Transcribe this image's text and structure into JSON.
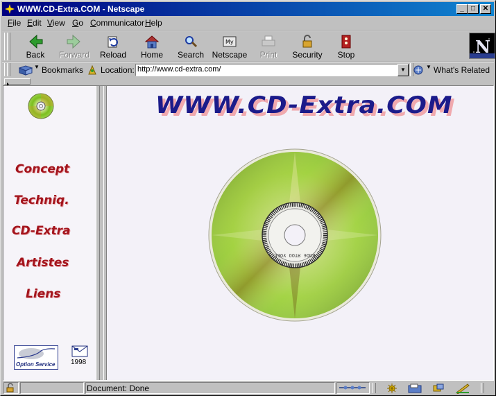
{
  "window": {
    "title": "WWW.CD-Extra.COM - Netscape"
  },
  "menu": [
    {
      "label": "File",
      "accel": "F"
    },
    {
      "label": "Edit",
      "accel": "E"
    },
    {
      "label": "View",
      "accel": "V"
    },
    {
      "label": "Go",
      "accel": "G"
    },
    {
      "label": "Communicator",
      "accel": "C"
    },
    {
      "label": "Help",
      "accel": "H"
    }
  ],
  "toolbar": {
    "back": "Back",
    "forward": "Forward",
    "reload": "Reload",
    "home": "Home",
    "search": "Search",
    "netscape": "Netscape",
    "print": "Print",
    "security": "Security",
    "stop": "Stop"
  },
  "location": {
    "bookmarks_label": "Bookmarks",
    "location_label": "Location:",
    "url": "http://www.cd-extra.com/",
    "related_label": "What's Related"
  },
  "page": {
    "site_title": "WWW.CD-Extra.COM",
    "nav": [
      "Concept",
      "Techniq.",
      "CD-Extra",
      "Artistes",
      "Liens"
    ],
    "option_logo_text": "Option Service",
    "year": "1998",
    "disc_text": "ВЛОЄ ЯТОО УОЕЛ"
  },
  "status": {
    "text": "Document: Done"
  },
  "colors": {
    "title_bar": "#000080",
    "nav_link": "#a3141c",
    "site_title": "#1b1b8a"
  }
}
